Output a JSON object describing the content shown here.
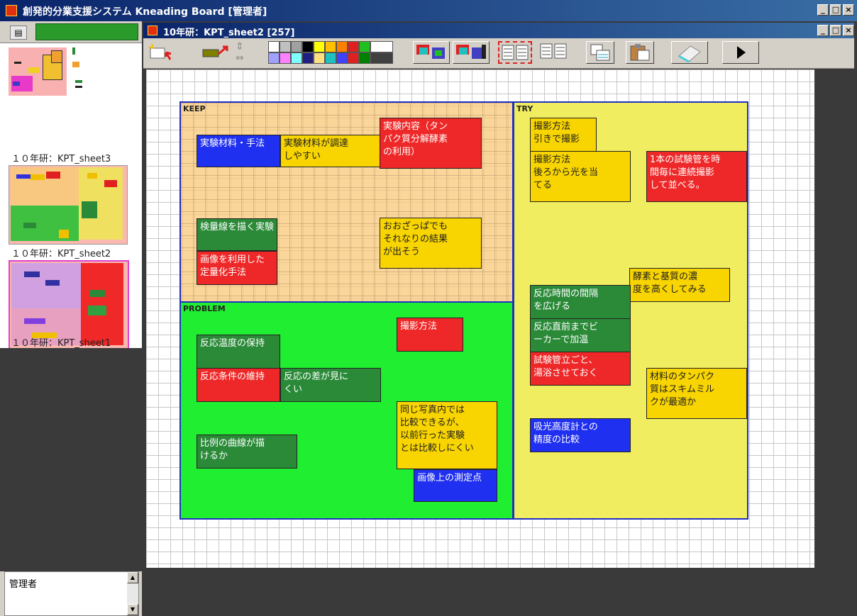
{
  "app": {
    "title": "創発的分業支援システム Kneading Board [管理者]",
    "window_buttons": [
      "_",
      "□",
      "×"
    ]
  },
  "left_panel": {
    "sheets": [
      {
        "label": "１０年研：KPT_sheet3"
      },
      {
        "label": "１０年研：KPT_sheet2"
      },
      {
        "label": "１０年研：KPT_sheet1"
      }
    ],
    "user": "管理者"
  },
  "child_window": {
    "title": "10年研：KPT_sheet2 [257]",
    "buttons": [
      "_",
      "□",
      "×"
    ]
  },
  "toolbar": {
    "tools": [
      "new-card-icon",
      "arrow-tool-icon",
      "line-tool-icon",
      "move-icon",
      "color-palette",
      "layout-a-icon",
      "layout-b-icon",
      "view-a-icon",
      "view-b-icon",
      "stack-icon",
      "clipboard-icon",
      "eraser-icon",
      "play-icon"
    ],
    "palette": [
      "#ffffff",
      "#c0c0c0",
      "#ff80ff",
      "#000000",
      "#ffff00",
      "#ff8000",
      "#ff0000",
      "#00c000",
      "#0000ff",
      "#ffffff",
      "#000000",
      "#a0a0ff",
      "#80ffff",
      "#00ff00",
      "#ffc040",
      "#00ffff",
      "#8080ff",
      "#c00000",
      "#008000",
      "#000080",
      "#808080",
      "#c04040"
    ]
  },
  "regions": {
    "keep": {
      "label": "KEEP"
    },
    "try": {
      "label": "TRY"
    },
    "problem": {
      "label": "PROBLEM"
    }
  },
  "cards": [
    {
      "text": "実験材料・手法",
      "color": "blue"
    },
    {
      "text": "実験材料が調達\nしやすい",
      "color": "yellow"
    },
    {
      "text": "実験内容（タン\nパク質分解酵素\nの利用）",
      "color": "red"
    },
    {
      "text": "検量線を描く実験",
      "color": "green"
    },
    {
      "text": "おおざっぱでも\nそれなりの結果\nが出そう",
      "color": "yellow"
    },
    {
      "text": "画像を利用した\n定量化手法",
      "color": "red"
    },
    {
      "text": "撮影方法\n引きで撮影",
      "color": "yellow"
    },
    {
      "text": "撮影方法\n後ろから光を当\nてる",
      "color": "yellow"
    },
    {
      "text": "1本の試験管を時\n間毎に連続撮影\nして並べる。",
      "color": "red"
    },
    {
      "text": "酵素と基質の濃\n度を高くしてみる",
      "color": "yellow"
    },
    {
      "text": "反応時間の間隔\nを広げる",
      "color": "green"
    },
    {
      "text": "反応直前までビ\nーカーで加温",
      "color": "green"
    },
    {
      "text": "試験管立ごと、\n湯浴させておく",
      "color": "red"
    },
    {
      "text": "材料のタンパク\n質はスキムミル\nクが最適か",
      "color": "yellow"
    },
    {
      "text": "吸光高度計との\n精度の比較",
      "color": "blue"
    },
    {
      "text": "撮影方法",
      "color": "red"
    },
    {
      "text": "反応温度の保持",
      "color": "green"
    },
    {
      "text": "反応条件の維持",
      "color": "red"
    },
    {
      "text": "反応の差が見に\nくい",
      "color": "green"
    },
    {
      "text": "同じ写真内では\n比較できるが、\n以前行った実験\nとは比較しにくい",
      "color": "yellow"
    },
    {
      "text": "比例の曲線が描\nけるか",
      "color": "green"
    },
    {
      "text": "画像上の測定点",
      "color": "blue"
    }
  ]
}
